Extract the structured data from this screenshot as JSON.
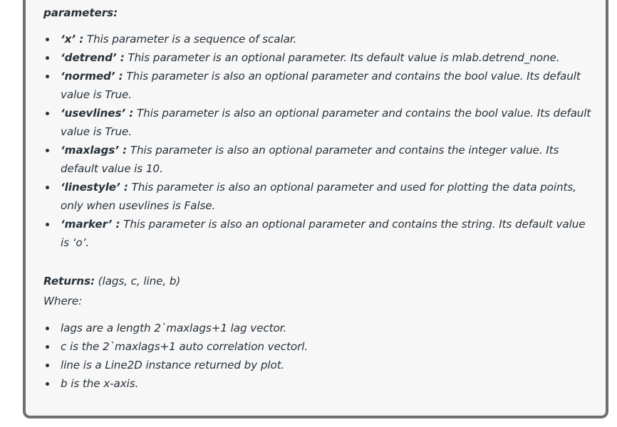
{
  "section": {
    "heading": "parameters:"
  },
  "parameters": [
    {
      "name": "‘x’ :",
      "desc": " This parameter is a sequence of scalar."
    },
    {
      "name": "‘detrend’ :",
      "desc": " This parameter is an optional parameter. Its default value is mlab.detrend_none."
    },
    {
      "name": "‘normed’ :",
      "desc": " This parameter is also an optional parameter and contains the bool value. Its default value is True."
    },
    {
      "name": "‘usevlines’ :",
      "desc": " This parameter is also an optional parameter and contains the bool value. Its default value is True."
    },
    {
      "name": "‘maxlags’ :",
      "desc": " This parameter is also an optional parameter and contains the integer value. Its default value is 10."
    },
    {
      "name": "‘linestyle’ :",
      "desc": " This parameter is also an optional parameter and used for plotting the data points, only when usevlines is False."
    },
    {
      "name": "‘marker’ :",
      "desc": " This parameter is also an optional parameter and contains the string. Its default value is ‘o’."
    }
  ],
  "returns": {
    "label": "Returns:",
    "value": " (lags, c, line, b)",
    "where_label": "Where:"
  },
  "where_items": [
    "lags are a length 2`maxlags+1 lag vector.",
    "c is the 2`maxlags+1 auto correlation vectorl.",
    "line is a Line2D instance returned by plot.",
    "b is the x-axis."
  ]
}
